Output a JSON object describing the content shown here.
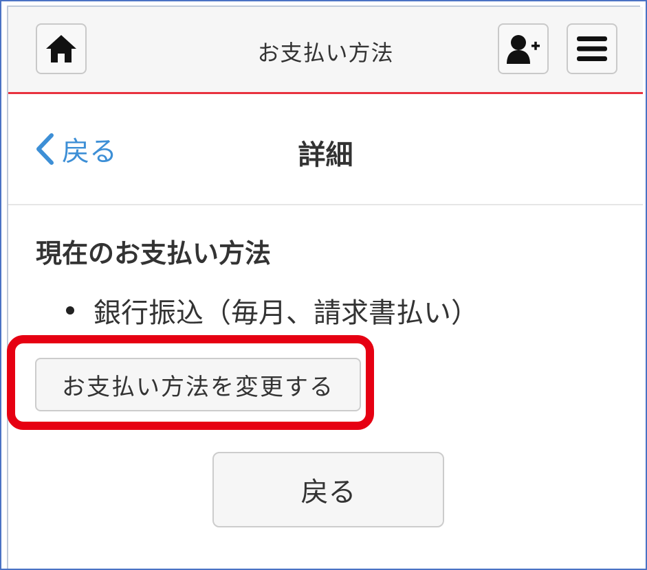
{
  "header": {
    "title": "お支払い方法",
    "home_icon": "home-icon",
    "add_user_icon": "add-user-icon",
    "menu_icon": "hamburger-menu-icon"
  },
  "subnav": {
    "back_label": "戻る",
    "title": "詳細"
  },
  "main": {
    "section_heading": "現在のお支払い方法",
    "payment_methods": [
      "銀行振込（毎月、請求書払い）"
    ],
    "change_button_label": "お支払い方法を変更する",
    "back_button_label": "戻る"
  },
  "colors": {
    "accent_red": "#e8323f",
    "highlight_red": "#e60012",
    "link_blue": "#3d8fd6",
    "frame_blue": "#4a72c4"
  }
}
